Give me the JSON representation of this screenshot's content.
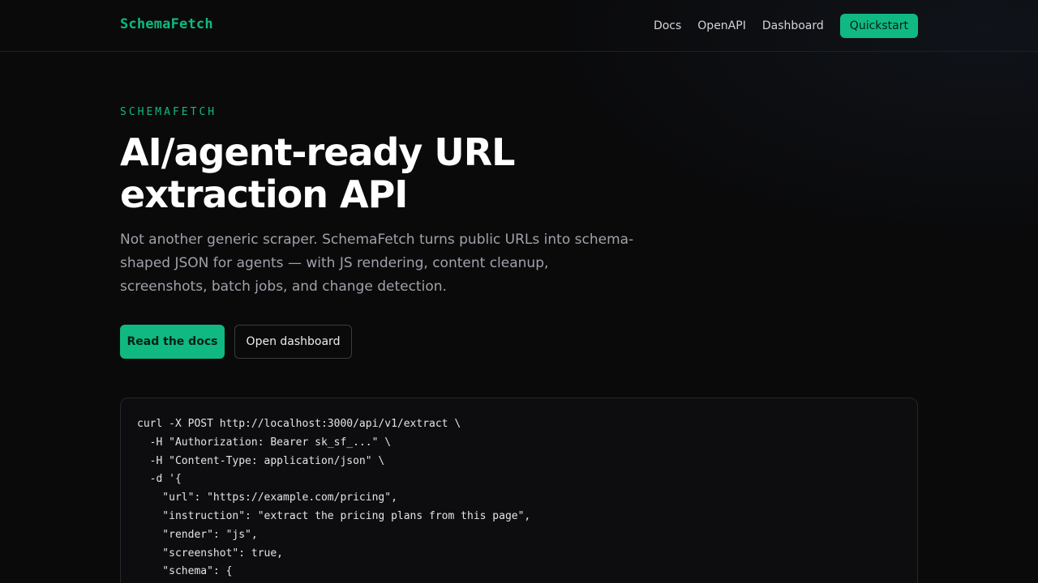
{
  "header": {
    "brand": "SchemaFetch",
    "nav": [
      {
        "label": "Docs"
      },
      {
        "label": "OpenAPI"
      },
      {
        "label": "Dashboard"
      }
    ],
    "cta_label": "Quickstart"
  },
  "hero": {
    "eyebrow": "SCHEMAFETCH",
    "title": "AI/agent-ready URL extraction API",
    "description": "Not another generic scraper. SchemaFetch turns public URLs into schema-shaped JSON for agents — with JS rendering, content cleanup, screenshots, batch jobs, and change detection.",
    "primary_button": "Read the docs",
    "secondary_button": "Open dashboard"
  },
  "code_sample": {
    "lines": [
      "curl -X POST http://localhost:3000/api/v1/extract \\",
      "  -H \"Authorization: Bearer sk_sf_...\" \\",
      "  -H \"Content-Type: application/json\" \\",
      "  -d '{",
      "    \"url\": \"https://example.com/pricing\",",
      "    \"instruction\": \"extract the pricing plans from this page\",",
      "    \"render\": \"js\",",
      "    \"screenshot\": true,",
      "    \"schema\": {"
    ]
  },
  "colors": {
    "accent": "#10b981",
    "background": "#0a0a0b"
  }
}
